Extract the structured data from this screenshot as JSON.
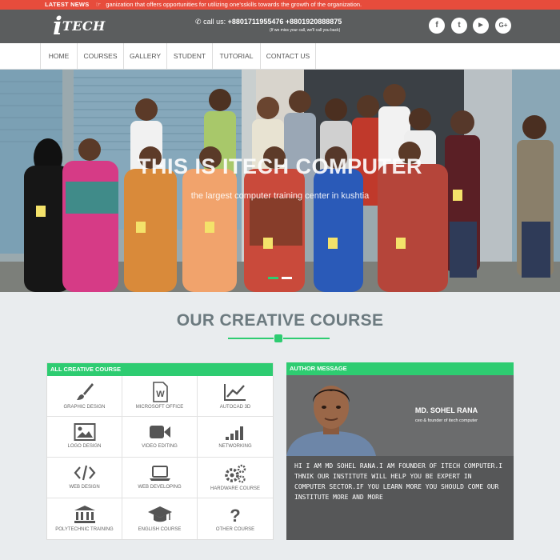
{
  "ticker": {
    "label": "LATEST NEWS",
    "icon": "pointing-hand-icon",
    "text": "ganization that offers opportunities for utilizing one'sskills towards the growth of the organization."
  },
  "header": {
    "logo_i": "i",
    "logo_rest": "TECH",
    "call_prefix": "call us:",
    "call_numbers": "+8801711955476 +8801920888875",
    "call_note": "(If we miss your call, we'll call you back)",
    "social": [
      {
        "icon": "facebook-icon",
        "glyph": "f"
      },
      {
        "icon": "twitter-icon",
        "glyph": "t"
      },
      {
        "icon": "youtube-icon",
        "glyph": "▶"
      },
      {
        "icon": "google-plus-icon",
        "glyph": "G+"
      }
    ]
  },
  "nav": {
    "items": [
      "HOME",
      "COURSES",
      "GALLERY",
      "STUDENT",
      "TUTORIAL",
      "CONTACT US"
    ]
  },
  "hero": {
    "title": "THIS IS ITECH COMPUTER",
    "subtitle": "the largest computer training center in kushtia",
    "active_slide": 1,
    "slide_count": 2
  },
  "section": {
    "title": "OUR CREATIVE COURSE"
  },
  "courses": {
    "heading": "ALL CREATIVE COURSE",
    "items": [
      {
        "label": "GRAPHIC DESIGN",
        "icon": "paint-brush-icon"
      },
      {
        "label": "MICROSOFT OFFICE",
        "icon": "word-document-icon"
      },
      {
        "label": "AUTOCAD 3D",
        "icon": "line-chart-icon"
      },
      {
        "label": "LOGO DESIGN",
        "icon": "picture-icon"
      },
      {
        "label": "VIDEO EDITING",
        "icon": "video-camera-icon"
      },
      {
        "label": "NETWORKING",
        "icon": "signal-bars-icon"
      },
      {
        "label": "WEB DESIGN",
        "icon": "code-icon"
      },
      {
        "label": "WEB DEVELOPING",
        "icon": "laptop-icon"
      },
      {
        "label": "HARDWARE COURSE",
        "icon": "gears-icon"
      },
      {
        "label": "POLYTECHNIC TRAINING",
        "icon": "institution-icon"
      },
      {
        "label": "ENGLISH COURSE",
        "icon": "graduation-cap-icon"
      },
      {
        "label": "OTHER COURSE",
        "icon": "question-mark-icon"
      }
    ]
  },
  "author": {
    "heading": "AUTHOR MESSAGE",
    "name": "MD. SOHEL RANA",
    "role": "ceo & founder of itech computer",
    "message": "HI I AM MD SOHEL RANA.I AM FOUNDER OF ITECH COMPUTER.I THNIK OUR INSTITUTE WILL HELP YOU BE EXPERT IN COMPUTER SECTOR.IF YOU LEARN MORE YOU SHOULD COME OUR INSTITUTE MORE AND MORE"
  },
  "colors": {
    "ticker_bg": "#e74c3c",
    "header_bg": "#5b5d5e",
    "accent_green": "#2ecc71",
    "title_gray": "#6c7a7f",
    "author_bg": "#6b6c6d"
  }
}
